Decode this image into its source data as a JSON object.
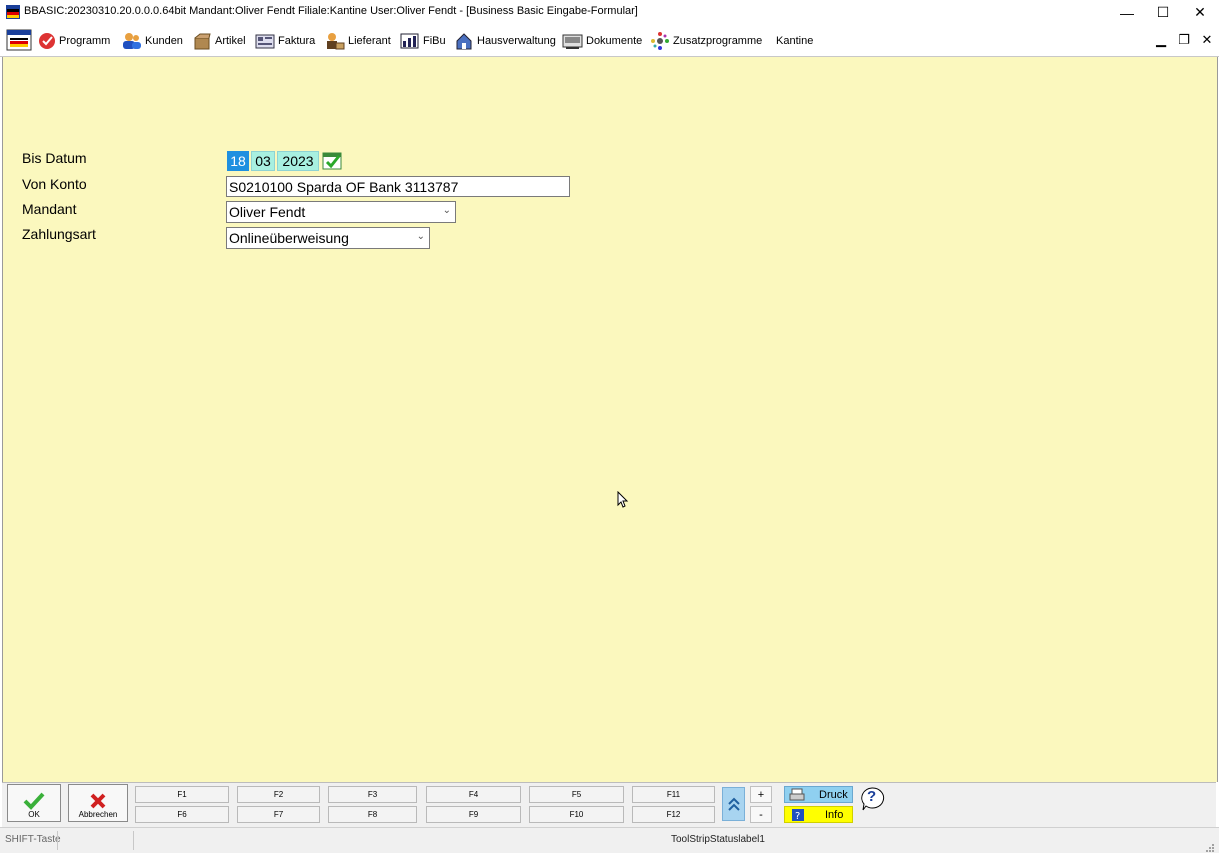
{
  "window": {
    "title": "BBASIC:20230310.20.0.0.0.64bit Mandant:Oliver Fendt Filiale:Kantine User:Oliver Fendt - [Business Basic Eingabe-Formular]",
    "minimize": "—",
    "maximize": "☐",
    "close": "✕"
  },
  "menu": {
    "items": [
      {
        "label": "Programm",
        "icon": "program-icon"
      },
      {
        "label": "Kunden",
        "icon": "customers-icon"
      },
      {
        "label": "Artikel",
        "icon": "articles-icon"
      },
      {
        "label": "Faktura",
        "icon": "invoice-icon"
      },
      {
        "label": "Lieferant",
        "icon": "supplier-icon"
      },
      {
        "label": "FiBu",
        "icon": "accounting-icon"
      },
      {
        "label": "Hausverwaltung",
        "icon": "property-icon"
      },
      {
        "label": "Dokumente",
        "icon": "documents-icon"
      },
      {
        "label": "Zusatzprogramme",
        "icon": "addons-icon"
      },
      {
        "label": "Kantine",
        "icon": ""
      }
    ],
    "mdi_minimize": "▁",
    "mdi_restore": "❐",
    "mdi_close": "✕"
  },
  "form": {
    "bis_datum_label": "Bis Datum",
    "date_day": "18",
    "date_month": "03",
    "date_year": "2023",
    "von_konto_label": "Von Konto",
    "von_konto_value": "S0210100 Sparda OF Bank 3113787",
    "mandant_label": "Mandant",
    "mandant_value": "Oliver Fendt",
    "zahlungsart_label": "Zahlungsart",
    "zahlungsart_value": "Onlineüberweisung"
  },
  "buttons": {
    "ok": "OK",
    "abbrechen": "Abbrechen",
    "fkeys_top": [
      "F1",
      "F2",
      "F3",
      "F4",
      "F5",
      "F11"
    ],
    "fkeys_bottom": [
      "F6",
      "F7",
      "F8",
      "F9",
      "F10",
      "F12"
    ],
    "plus": "+",
    "minus": "-",
    "druck": "Druck",
    "info": "Info",
    "help": "?"
  },
  "status": {
    "shift": "SHIFT-Taste",
    "label1": "ToolStripStatuslabel1"
  },
  "colors": {
    "form_background": "#fbf8be",
    "date_day_bg": "#1e90e0",
    "date_bg": "#a8f0e0",
    "info_bg": "#ffff00",
    "druck_bg": "#8fd0f0"
  }
}
